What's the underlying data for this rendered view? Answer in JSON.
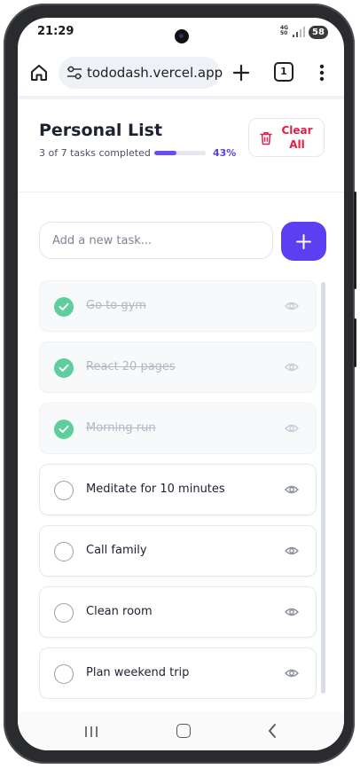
{
  "status_bar": {
    "time": "21:29",
    "network": "4G",
    "network_speed": "50",
    "battery": "58"
  },
  "browser": {
    "url": "tododash.vercel.app",
    "tab_count": "1"
  },
  "app": {
    "title": "Personal List",
    "progress_text": "3 of 7 tasks completed",
    "progress_percent": "43%",
    "progress_fraction": 0.43,
    "clear_label_line1": "Clear",
    "clear_label_line2": "All",
    "input_placeholder": "Add a new task...",
    "accent_color": "#5b3ff0",
    "done_color": "#5fce9d",
    "danger_color": "#e11d48"
  },
  "tasks": [
    {
      "label": "Go to gym",
      "done": true
    },
    {
      "label": "React 20 pages",
      "done": true
    },
    {
      "label": "Morning run",
      "done": true
    },
    {
      "label": "Meditate for 10 minutes",
      "done": false
    },
    {
      "label": "Call family",
      "done": false
    },
    {
      "label": "Clean room",
      "done": false
    },
    {
      "label": "Plan weekend trip",
      "done": false
    }
  ],
  "icons": {
    "home": "home-icon",
    "site_settings": "tune-icon",
    "new_tab": "plus-icon",
    "tabs": "tabs-icon",
    "menu": "more-vert-icon",
    "clear": "trash-icon",
    "add": "plus-icon",
    "view": "eye-icon",
    "complete": "check-icon"
  }
}
